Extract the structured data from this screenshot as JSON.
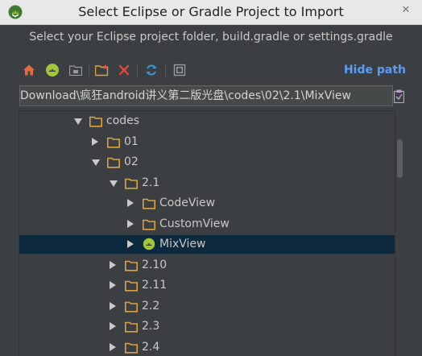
{
  "window": {
    "title": "Select Eclipse or Gradle Project to Import",
    "close_glyph": "✕"
  },
  "subtitle": "Select your Eclipse project folder, build.gradle or settings.gradle",
  "toolbar": {
    "buttons": [
      "home-icon",
      "android-project-icon",
      "module-folder-icon",
      "new-folder-icon",
      "delete-icon",
      "refresh-icon",
      "show-hidden-icon"
    ],
    "hide_path_label": "Hide path"
  },
  "path": {
    "value": "Download\\疯狂android讲义第二版光盘\\codes\\02\\2.1\\MixView"
  },
  "tree": {
    "rows": [
      {
        "label": "codes",
        "state": "expanded",
        "icon": "folder"
      },
      {
        "label": "01",
        "state": "collapsed",
        "icon": "folder"
      },
      {
        "label": "02",
        "state": "expanded",
        "icon": "folder"
      },
      {
        "label": "2.1",
        "state": "expanded",
        "icon": "folder"
      },
      {
        "label": "CodeView",
        "state": "collapsed",
        "icon": "folder"
      },
      {
        "label": "CustomView",
        "state": "collapsed",
        "icon": "folder"
      },
      {
        "label": "MixView",
        "state": "collapsed",
        "icon": "android",
        "selected": true
      },
      {
        "label": "2.10",
        "state": "collapsed",
        "icon": "folder"
      },
      {
        "label": "2.11",
        "state": "collapsed",
        "icon": "folder"
      },
      {
        "label": "2.2",
        "state": "collapsed",
        "icon": "folder"
      },
      {
        "label": "2.3",
        "state": "collapsed",
        "icon": "folder"
      },
      {
        "label": "2.4",
        "state": "collapsed",
        "icon": "folder"
      }
    ]
  },
  "colors": {
    "background": "#3c3f41",
    "selection": "#0d293e",
    "accent_link": "#589df6",
    "folder": "#d9a343",
    "android": "#a4c639"
  }
}
